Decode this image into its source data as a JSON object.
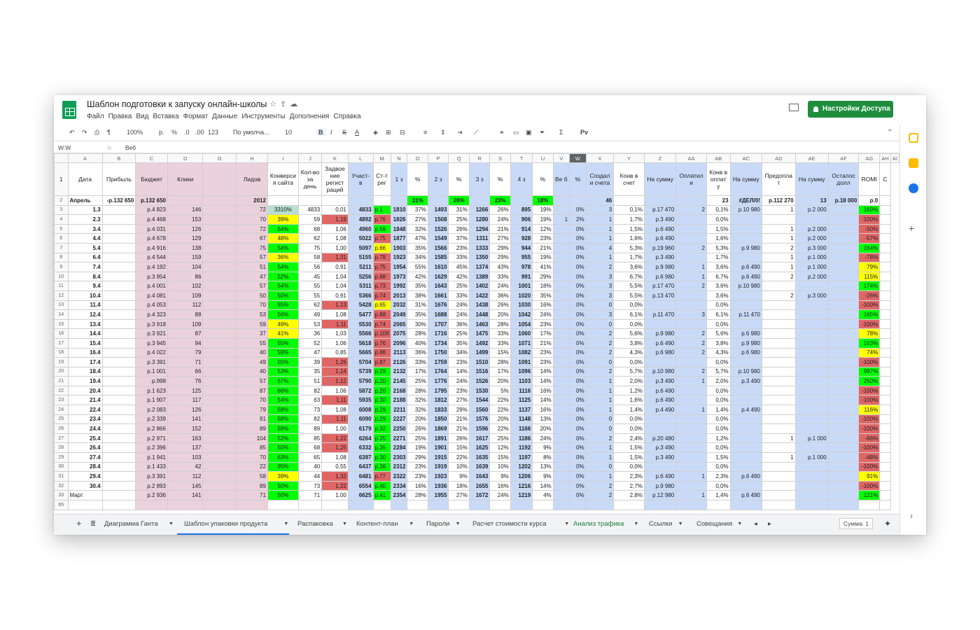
{
  "doc": {
    "title": "Шаблон подготовки к запуску онлайн-школы",
    "menus": [
      "Файл",
      "Правка",
      "Вид",
      "Вставка",
      "Формат",
      "Данные",
      "Инструменты",
      "Дополнения",
      "Справка"
    ],
    "share": "Настройки Доступа"
  },
  "toolbar": {
    "zoom": "100%",
    "currency": "р.",
    "percent": "%",
    "dec1": ".0",
    "dec2": ".00",
    "fmt": "123",
    "font": "По умолча...",
    "size": "10",
    "bold": "B",
    "italic": "I",
    "strike": "S",
    "color": "A",
    "sigma": "Σ",
    "script": "Рv"
  },
  "formula": {
    "cell": "W:W",
    "fx": "fx",
    "content": "Веб"
  },
  "cols": [
    "A",
    "B",
    "C",
    "D",
    "G",
    "H",
    "I",
    "J",
    "K",
    "L",
    "M",
    "N",
    "O",
    "P",
    "Q",
    "R",
    "S",
    "T",
    "U",
    "V",
    "W",
    "X",
    "Y",
    "Z",
    "AA",
    "AB",
    "AC",
    "AD",
    "AE",
    "AF",
    "AG",
    "AH",
    "AI"
  ],
  "headers": [
    "Дата",
    "Прибыль",
    "Бюджет",
    "Клики",
    "",
    "Лидов",
    "Конверси я сайта",
    "Кол-во за день",
    "Задвое ние регист раций",
    "Участ- в",
    "Ст-т рег",
    "1 з",
    "%",
    "2 з",
    "%",
    "3 з",
    "%",
    "4 з",
    "%",
    "Ве б",
    "%",
    "Создал и счета",
    "Конв в счет",
    "На сумму",
    "Оплатил и",
    "Конв в оплат у",
    "На сумму",
    "Предопла т",
    "На сумму",
    "Осталос долл",
    "ROMI",
    "С"
  ],
  "row2": [
    "Апрель",
    "-р.132 650",
    "р.132 650",
    "",
    "",
    "2012",
    "",
    "",
    "",
    "",
    "",
    "",
    "31%",
    "",
    "26%",
    "",
    "23%",
    "",
    "18%",
    "",
    "",
    "46",
    "",
    "",
    "",
    "23",
    "#ДЕЛ/0!",
    "р.112 270",
    "13",
    "р.18 000",
    "р.0",
    "",
    ""
  ],
  "rows": [
    [
      "1.3",
      "р.4 823",
      "146",
      "72",
      "3310%",
      "4833",
      "0,01",
      "4833",
      "р.1",
      "1810",
      "37%",
      "1493",
      "31%",
      "1266",
      "26%",
      "895",
      "19%",
      "",
      "0%",
      "3",
      "0,1%",
      "р.17 470",
      "2",
      "0,1%",
      "р.10 980",
      "1",
      "р.2 000",
      "",
      "169%"
    ],
    [
      "2.3",
      "р.4 468",
      "153",
      "70",
      "39%",
      "59",
      "1,19",
      "4892",
      "р.76",
      "1826",
      "27%",
      "1508",
      "25%",
      "1280",
      "24%",
      "906",
      "19%",
      "1",
      "2%",
      "1",
      "1,7%",
      "р.3 490",
      "",
      "0,0%",
      "",
      "",
      "",
      "",
      "-100%"
    ],
    [
      "3.4",
      "р.4 031",
      "126",
      "72",
      "54%",
      "68",
      "1,06",
      "4960",
      "р.59",
      "1848",
      "32%",
      "1526",
      "26%",
      "1294",
      "21%",
      "914",
      "12%",
      "",
      "0%",
      "1",
      "1,5%",
      "р.6 490",
      "",
      "1,5%",
      "",
      "1",
      "р.2 000",
      "",
      "-50%"
    ],
    [
      "4.4",
      "р.4 678",
      "129",
      "67",
      "48%",
      "62",
      "1,08",
      "5022",
      "р.75",
      "1877",
      "47%",
      "1549",
      "37%",
      "1311",
      "27%",
      "928",
      "23%",
      "",
      "0%",
      "1",
      "1,6%",
      "р.6 490",
      "",
      "1,6%",
      "",
      "1",
      "р.2 000",
      "",
      "-57%"
    ],
    [
      "5.4",
      "р.4 916",
      "138",
      "75",
      "54%",
      "75",
      "1,00",
      "5097",
      "р.66",
      "1903",
      "35%",
      "1566",
      "23%",
      "1333",
      "29%",
      "944",
      "21%",
      "",
      "0%",
      "4",
      "5,3%",
      "р.19 960",
      "2",
      "5,3%",
      "р.9 980",
      "2",
      "р.3 000",
      "",
      "164%"
    ],
    [
      "6.4",
      "р.4 544",
      "159",
      "57",
      "36%",
      "58",
      "1,31",
      "5155",
      "р.78",
      "1923",
      "34%",
      "1585",
      "33%",
      "1350",
      "29%",
      "955",
      "19%",
      "",
      "0%",
      "1",
      "1,7%",
      "р.3 490",
      "",
      "1,7%",
      "",
      "1",
      "р.1 000",
      "",
      "-78%"
    ],
    [
      "7.4",
      "р.4 192",
      "104",
      "51",
      "54%",
      "56",
      "0,91",
      "5211",
      "р.75",
      "1954",
      "55%",
      "1610",
      "45%",
      "1374",
      "43%",
      "978",
      "41%",
      "",
      "0%",
      "2",
      "3,6%",
      "р.9 980",
      "1",
      "3,6%",
      "р.6 490",
      "1",
      "р.1 000",
      "",
      "79%"
    ],
    [
      "8.4",
      "р.3 954",
      "86",
      "47",
      "52%",
      "45",
      "1,04",
      "5256",
      "р.88",
      "1973",
      "42%",
      "1629",
      "42%",
      "1389",
      "33%",
      "991",
      "29%",
      "",
      "0%",
      "3",
      "6,7%",
      "р.6 980",
      "1",
      "6,7%",
      "р.6 490",
      "2",
      "р.2 000",
      "",
      "115%"
    ],
    [
      "9.4",
      "р.4 001",
      "102",
      "57",
      "54%",
      "55",
      "1,04",
      "5311",
      "р.73",
      "1992",
      "35%",
      "1643",
      "25%",
      "1402",
      "24%",
      "1001",
      "18%",
      "",
      "0%",
      "3",
      "5,5%",
      "р.17 470",
      "2",
      "3,6%",
      "р.10 980",
      "",
      "",
      "",
      "174%"
    ],
    [
      "10.4",
      "р.4 081",
      "109",
      "50",
      "50%",
      "55",
      "0,91",
      "5366",
      "р.74",
      "2013",
      "38%",
      "1661",
      "33%",
      "1422",
      "36%",
      "1020",
      "35%",
      "",
      "0%",
      "3",
      "5,5%",
      "р.13 470",
      "",
      "3,6%",
      "",
      "2",
      "р.3 000",
      "",
      "-26%"
    ],
    [
      "11.4",
      "р.4 053",
      "112",
      "70",
      "55%",
      "62",
      "1,13",
      "5428",
      "р.65",
      "2032",
      "31%",
      "1676",
      "24%",
      "1438",
      "26%",
      "1030",
      "16%",
      "",
      "0%",
      "0",
      "0,0%",
      "",
      "",
      "0,0%",
      "",
      "",
      "",
      "",
      "-100%"
    ],
    [
      "12.4",
      "р.4 323",
      "88",
      "53",
      "56%",
      "49",
      "1,08",
      "5477",
      "р.88",
      "2049",
      "35%",
      "1688",
      "24%",
      "1448",
      "20%",
      "1042",
      "24%",
      "",
      "0%",
      "3",
      "6,1%",
      "р.11 470",
      "3",
      "6,1%",
      "р.11 470",
      "",
      "",
      "",
      "165%"
    ],
    [
      "13.4",
      "р.3 918",
      "109",
      "59",
      "49%",
      "53",
      "1,11",
      "5530",
      "р.74",
      "2065",
      "30%",
      "1707",
      "36%",
      "1463",
      "28%",
      "1054",
      "23%",
      "",
      "0%",
      "0",
      "0,0%",
      "",
      "",
      "0,0%",
      "",
      "",
      "",
      "",
      "-100%"
    ],
    [
      "14.4",
      "р.3 921",
      "87",
      "37",
      "41%",
      "36",
      "1,03",
      "5566",
      "р.109",
      "2075",
      "28%",
      "1716",
      "25%",
      "1475",
      "33%",
      "1060",
      "17%",
      "",
      "0%",
      "2",
      "5,6%",
      "р.9 980",
      "2",
      "5,6%",
      "р.6 980",
      "",
      "",
      "",
      "78%"
    ],
    [
      "15.4",
      "р.3 945",
      "94",
      "55",
      "55%",
      "52",
      "1,06",
      "5618",
      "р.76",
      "2096",
      "40%",
      "1734",
      "35%",
      "1492",
      "33%",
      "1071",
      "21%",
      "",
      "0%",
      "2",
      "3,8%",
      "р.6 490",
      "2",
      "3,8%",
      "р.9 980",
      "",
      "",
      "",
      "153%"
    ],
    [
      "16.4",
      "р.4 022",
      "79",
      "40",
      "59%",
      "47",
      "0,85",
      "5665",
      "р.86",
      "2113",
      "36%",
      "1750",
      "34%",
      "1499",
      "15%",
      "1082",
      "23%",
      "",
      "0%",
      "2",
      "4,3%",
      "р.6 980",
      "2",
      "4,3%",
      "р.6 980",
      "",
      "",
      "",
      "74%"
    ],
    [
      "17.4",
      "р.3 391",
      "71",
      "49",
      "55%",
      "39",
      "1,26",
      "5704",
      "р.87",
      "2126",
      "33%",
      "1759",
      "23%",
      "1510",
      "28%",
      "1091",
      "23%",
      "",
      "0%",
      "0",
      "0,0%",
      "",
      "",
      "0,0%",
      "",
      "",
      "",
      "",
      "-100%"
    ],
    [
      "18.4",
      "р.1 001",
      "66",
      "40",
      "53%",
      "35",
      "1,14",
      "5739",
      "р.29",
      "2132",
      "17%",
      "1764",
      "14%",
      "1516",
      "17%",
      "1096",
      "14%",
      "",
      "0%",
      "2",
      "5,7%",
      "р.10 980",
      "2",
      "5,7%",
      "р.10 980",
      "",
      "",
      "",
      "997%"
    ],
    [
      "19.4",
      "р.998",
      "76",
      "57",
      "67%",
      "51",
      "1,12",
      "5790",
      "р.20",
      "2145",
      "25%",
      "1776",
      "24%",
      "1526",
      "20%",
      "1103",
      "14%",
      "",
      "0%",
      "1",
      "2,0%",
      "р.3 490",
      "1",
      "2,0%",
      "р.3 490",
      "",
      "",
      "",
      "250%"
    ],
    [
      "20.4",
      "р.1 623",
      "125",
      "87",
      "66%",
      "82",
      "1,06",
      "5872",
      "р.20",
      "2168",
      "28%",
      "1795",
      "23%",
      "1530",
      "5%",
      "1116",
      "16%",
      "",
      "0%",
      "1",
      "1,2%",
      "р.6 490",
      "",
      "0,0%",
      "",
      "",
      "",
      "",
      "-100%"
    ],
    [
      "21.4",
      "р.1 907",
      "117",
      "70",
      "54%",
      "63",
      "1,11",
      "5935",
      "р.30",
      "2188",
      "32%",
      "1812",
      "27%",
      "1544",
      "22%",
      "1125",
      "14%",
      "",
      "0%",
      "1",
      "1,6%",
      "р.6 490",
      "",
      "0,0%",
      "",
      "",
      "",
      "",
      "-100%"
    ],
    [
      "22.4",
      "р.2 083",
      "126",
      "79",
      "58%",
      "73",
      "1,08",
      "6008",
      "р.29",
      "2211",
      "32%",
      "1833",
      "29%",
      "1560",
      "22%",
      "1137",
      "16%",
      "",
      "0%",
      "1",
      "1,4%",
      "р.4 490",
      "1",
      "1,4%",
      "р.4 490",
      "",
      "",
      "",
      "116%"
    ],
    [
      "23.4",
      "р.2 339",
      "141",
      "91",
      "58%",
      "82",
      "1,11",
      "6090",
      "р.29",
      "2227",
      "20%",
      "1850",
      "21%",
      "1576",
      "20%",
      "1148",
      "13%",
      "",
      "0%",
      "0",
      "0,0%",
      "",
      "",
      "0,0%",
      "",
      "",
      "",
      "",
      "-100%"
    ],
    [
      "24.4",
      "р.2 866",
      "152",
      "89",
      "59%",
      "89",
      "1,00",
      "6179",
      "р.32",
      "2250",
      "26%",
      "1869",
      "21%",
      "1596",
      "22%",
      "1166",
      "20%",
      "",
      "0%",
      "0",
      "0,0%",
      "",
      "",
      "0,0%",
      "",
      "",
      "",
      "",
      "-100%"
    ],
    [
      "25.4",
      "р.2 971",
      "163",
      "104",
      "52%",
      "85",
      "1,22",
      "6264",
      "р.35",
      "2271",
      "25%",
      "1891",
      "26%",
      "1617",
      "25%",
      "1186",
      "24%",
      "",
      "0%",
      "2",
      "2,4%",
      "р.20 480",
      "",
      "1,2%",
      "",
      "1",
      "р.1 000",
      "",
      "-66%"
    ],
    [
      "26.4",
      "р.2 396",
      "137",
      "85",
      "50%",
      "68",
      "1,25",
      "6332",
      "р.35",
      "2284",
      "19%",
      "1901",
      "15%",
      "1625",
      "12%",
      "1192",
      "9%",
      "",
      "0%",
      "1",
      "1,5%",
      "р.3 490",
      "",
      "0,0%",
      "",
      "",
      "",
      "",
      "-100%"
    ],
    [
      "27.4",
      "р.1 941",
      "103",
      "70",
      "63%",
      "65",
      "1,08",
      "6397",
      "р.30",
      "2303",
      "29%",
      "1915",
      "22%",
      "1635",
      "15%",
      "1197",
      "8%",
      "",
      "0%",
      "1",
      "1,5%",
      "р.3 490",
      "",
      "1,5%",
      "",
      "1",
      "р.1 000",
      "",
      "-48%"
    ],
    [
      "28.4",
      "р.1 433",
      "42",
      "22",
      "95%",
      "40",
      "0,55",
      "6437",
      "р.36",
      "2312",
      "23%",
      "1919",
      "10%",
      "1639",
      "10%",
      "1202",
      "13%",
      "",
      "0%",
      "0",
      "0,0%",
      "",
      "",
      "0,0%",
      "",
      "",
      "",
      "",
      "-100%"
    ],
    [
      "29.4",
      "р.3 391",
      "112",
      "58",
      "39%",
      "44",
      "1,32",
      "6481",
      "р.77",
      "2322",
      "23%",
      "1923",
      "9%",
      "1643",
      "9%",
      "1206",
      "9%",
      "",
      "0%",
      "1",
      "2,3%",
      "р.6 490",
      "1",
      "2,3%",
      "р.6 490",
      "",
      "",
      "",
      "91%"
    ],
    [
      "30.4",
      "р.2 893",
      "145",
      "89",
      "50%",
      "73",
      "1,22",
      "6554",
      "р.40",
      "2334",
      "16%",
      "1936",
      "18%",
      "1655",
      "16%",
      "1216",
      "14%",
      "",
      "0%",
      "2",
      "2,7%",
      "р.9 980",
      "",
      "0,0%",
      "",
      "",
      "",
      "",
      "-100%"
    ],
    [
      "Март",
      "р.2 936",
      "141",
      "71",
      "50%",
      "71",
      "1,00",
      "6625",
      "р.41",
      "2354",
      "28%",
      "1955",
      "27%",
      "1672",
      "24%",
      "1219",
      "4%",
      "",
      "0%",
      "2",
      "2,8%",
      "р.12 980",
      "1",
      "1,4%",
      "р.6 490",
      "",
      "",
      "",
      "121%"
    ]
  ],
  "rownums": [
    "3",
    "4",
    "5",
    "6",
    "7",
    "8",
    "9",
    "10",
    "11",
    "12",
    "13",
    "14",
    "15",
    "16",
    "17",
    "18",
    "19",
    "20",
    "21",
    "22",
    "23",
    "24",
    "25",
    "26",
    "27",
    "28",
    "29",
    "30",
    "31",
    "32",
    "33"
  ],
  "row65": "65",
  "tabs": [
    "Диаграмма Ганта",
    "Шаблон упаковки продукта",
    "Распаковка",
    "Контент-план",
    "Пароли",
    "Расчет стоимости курса",
    "Анализ трафика",
    "Ссылки",
    "Совещания"
  ],
  "sum": "Сумма: 1",
  "colors": {
    "green": "#00ff00",
    "yellow": "#ffff00",
    "red": "#e06666",
    "blue": "#c9daf8",
    "pink": "#ead1dc",
    "share": "#1e8e3e"
  }
}
